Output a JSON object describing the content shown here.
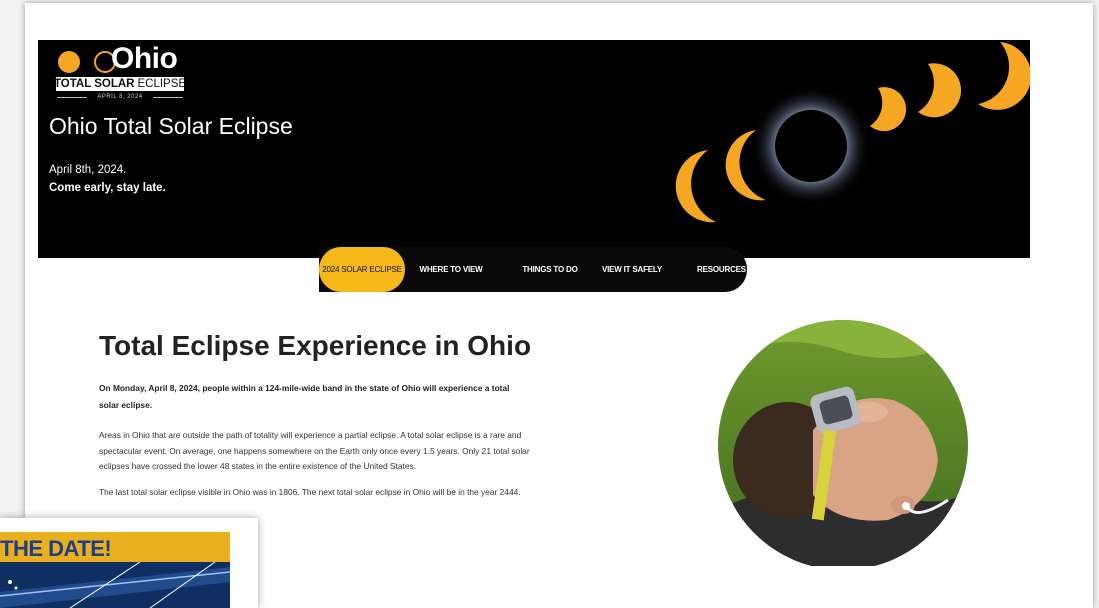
{
  "hero": {
    "logo_word": "Ohio",
    "logo_bar_bold": "TOTAL SOLAR",
    "logo_bar_rest": "ECLIPSE",
    "logo_date": "APRIL 8, 2024",
    "title": "Ohio Total Solar Eclipse",
    "date": "April 8th, 2024.",
    "tagline": "Come early, stay late."
  },
  "nav": {
    "items": [
      {
        "label": "2024 SOLAR ECLIPSE"
      },
      {
        "label": "WHERE TO VIEW"
      },
      {
        "label": "THINGS TO DO"
      },
      {
        "label": "VIEW IT SAFELY"
      },
      {
        "label": "RESOURCES"
      }
    ]
  },
  "main": {
    "heading": "Total Eclipse Experience in Ohio",
    "lead": "On Monday, April 8, 2024, people within a 124-mile-wide band in the state of Ohio will experience a total solar eclipse.",
    "paragraph1": "Areas in Ohio that are outside the path of totality will experience a partial eclipse. A total solar eclipse is a rare and spectacular event. On average, one happens somewhere on the Earth only once every 1.5 years. Only 21 total solar eclipses have crossed the lower 48 states in the entire existence of the United States.",
    "paragraph2": "The last total solar eclipse visible in Ohio was in 1806. The next total solar eclipse in Ohio will be in the year 2444."
  },
  "overlay": {
    "text": "THE DATE!"
  },
  "colors": {
    "accent": "#f7b81a",
    "hero_bg": "#000000",
    "nav_bg": "#0a0a0a"
  }
}
